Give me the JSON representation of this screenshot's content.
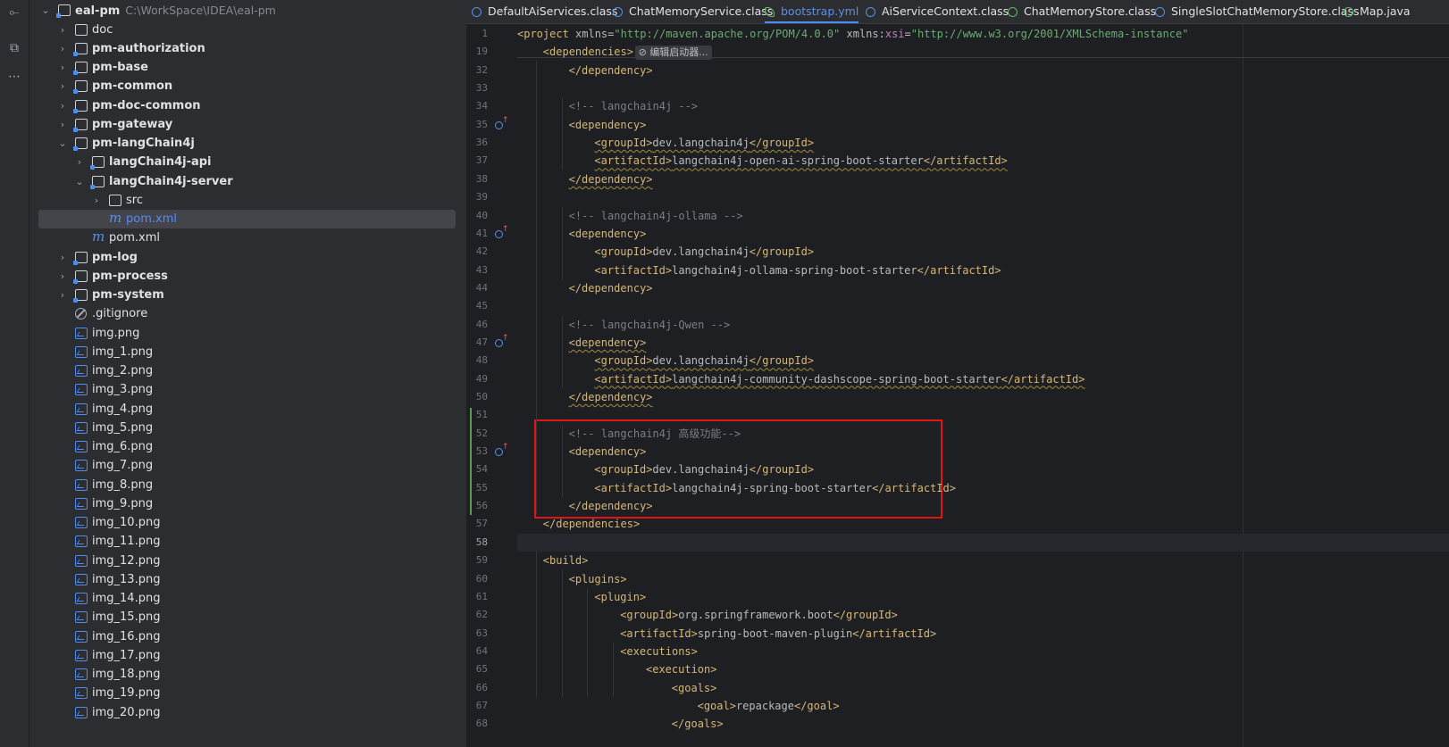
{
  "tree": {
    "root": {
      "name": "eal-pm",
      "path": "C:\\WorkSpace\\IDEA\\eal-pm"
    },
    "items": [
      {
        "label": "doc",
        "level": 1,
        "kind": "folder",
        "bold": false
      },
      {
        "label": "pm-authorization",
        "level": 1,
        "kind": "module",
        "bold": true
      },
      {
        "label": "pm-base",
        "level": 1,
        "kind": "module",
        "bold": true
      },
      {
        "label": "pm-common",
        "level": 1,
        "kind": "module",
        "bold": true
      },
      {
        "label": "pm-doc-common",
        "level": 1,
        "kind": "module",
        "bold": true
      },
      {
        "label": "pm-gateway",
        "level": 1,
        "kind": "module",
        "bold": true
      },
      {
        "label": "pm-langChain4j",
        "level": 1,
        "kind": "module",
        "bold": true,
        "expanded": true
      },
      {
        "label": "langChain4j-api",
        "level": 2,
        "kind": "module",
        "bold": true
      },
      {
        "label": "langChain4j-server",
        "level": 2,
        "kind": "module",
        "bold": true,
        "expanded": true
      },
      {
        "label": "src",
        "level": 3,
        "kind": "folder",
        "bold": false
      },
      {
        "label": "pom.xml",
        "level": 3,
        "kind": "maven",
        "bold": false,
        "selected": true
      },
      {
        "label": "pom.xml",
        "level": 2,
        "kind": "maven",
        "bold": false
      },
      {
        "label": "pm-log",
        "level": 1,
        "kind": "module",
        "bold": true
      },
      {
        "label": "pm-process",
        "level": 1,
        "kind": "module",
        "bold": true
      },
      {
        "label": "pm-system",
        "level": 1,
        "kind": "module",
        "bold": true
      },
      {
        "label": ".gitignore",
        "level": 1,
        "kind": "ignore",
        "bold": false
      },
      {
        "label": "img.png",
        "level": 1,
        "kind": "image",
        "bold": false
      },
      {
        "label": "img_1.png",
        "level": 1,
        "kind": "image",
        "bold": false
      },
      {
        "label": "img_2.png",
        "level": 1,
        "kind": "image",
        "bold": false
      },
      {
        "label": "img_3.png",
        "level": 1,
        "kind": "image",
        "bold": false
      },
      {
        "label": "img_4.png",
        "level": 1,
        "kind": "image",
        "bold": false
      },
      {
        "label": "img_5.png",
        "level": 1,
        "kind": "image",
        "bold": false
      },
      {
        "label": "img_6.png",
        "level": 1,
        "kind": "image",
        "bold": false
      },
      {
        "label": "img_7.png",
        "level": 1,
        "kind": "image",
        "bold": false
      },
      {
        "label": "img_8.png",
        "level": 1,
        "kind": "image",
        "bold": false
      },
      {
        "label": "img_9.png",
        "level": 1,
        "kind": "image",
        "bold": false
      },
      {
        "label": "img_10.png",
        "level": 1,
        "kind": "image",
        "bold": false
      },
      {
        "label": "img_11.png",
        "level": 1,
        "kind": "image",
        "bold": false
      },
      {
        "label": "img_12.png",
        "level": 1,
        "kind": "image",
        "bold": false
      },
      {
        "label": "img_13.png",
        "level": 1,
        "kind": "image",
        "bold": false
      },
      {
        "label": "img_14.png",
        "level": 1,
        "kind": "image",
        "bold": false
      },
      {
        "label": "img_15.png",
        "level": 1,
        "kind": "image",
        "bold": false
      },
      {
        "label": "img_16.png",
        "level": 1,
        "kind": "image",
        "bold": false
      },
      {
        "label": "img_17.png",
        "level": 1,
        "kind": "image",
        "bold": false
      },
      {
        "label": "img_18.png",
        "level": 1,
        "kind": "image",
        "bold": false
      },
      {
        "label": "img_19.png",
        "level": 1,
        "kind": "image",
        "bold": false
      },
      {
        "label": "img_20.png",
        "level": 1,
        "kind": "image",
        "bold": false
      }
    ]
  },
  "tabs": [
    {
      "label": "DefaultAiServices.class",
      "icon": "class"
    },
    {
      "label": "ChatMemoryService.class",
      "icon": "class"
    },
    {
      "label": "bootstrap.yml",
      "icon": "spring-leaf",
      "active": true
    },
    {
      "label": "AiServiceContext.class",
      "icon": "class"
    },
    {
      "label": "ChatMemoryStore.class",
      "icon": "interface"
    },
    {
      "label": "SingleSlotChatMemoryStore.class",
      "icon": "class"
    },
    {
      "label": "Map.java",
      "icon": "interface"
    }
  ],
  "inlay_hint": "编辑启动器...",
  "current_line": "58",
  "code": [
    {
      "n": "1",
      "indent": 0,
      "tokens": [
        [
          "t",
          "<project "
        ],
        [
          "a",
          "xmlns="
        ],
        [
          "s",
          "\"http://maven.apache.org/POM/4.0.0\""
        ],
        [
          "a",
          " xmlns:"
        ],
        [
          "ns",
          "xsi"
        ],
        [
          "a",
          "="
        ],
        [
          "s",
          "\"http://www.w3.org/2001/XMLSchema-instance\""
        ]
      ]
    },
    {
      "n": "19",
      "indent": 1,
      "tokens": [
        [
          "t",
          "<dependencies>"
        ]
      ]
    },
    {
      "n": "32",
      "indent": 2,
      "tokens": [
        [
          "t",
          "</dependency>"
        ]
      ]
    },
    {
      "n": "33",
      "indent": 0,
      "tokens": []
    },
    {
      "n": "34",
      "indent": 2,
      "tokens": [
        [
          "c",
          "<!-- langchain4j -->"
        ]
      ]
    },
    {
      "n": "35",
      "indent": 2,
      "marker": true,
      "tokens": [
        [
          "t",
          "<dependency>"
        ]
      ]
    },
    {
      "n": "36",
      "indent": 3,
      "wavy": true,
      "tokens": [
        [
          "t",
          "<groupId>"
        ],
        [
          "a",
          "dev.langchain4j"
        ],
        [
          "t",
          "</groupId>"
        ]
      ]
    },
    {
      "n": "37",
      "indent": 3,
      "wavy": true,
      "tokens": [
        [
          "t",
          "<artifactId>"
        ],
        [
          "a",
          "langchain4j-open-ai-spring-boot-starter"
        ],
        [
          "t",
          "</artifactId>"
        ]
      ]
    },
    {
      "n": "38",
      "indent": 2,
      "wavy": true,
      "tokens": [
        [
          "t",
          "</dependency>"
        ]
      ]
    },
    {
      "n": "39",
      "indent": 0,
      "tokens": []
    },
    {
      "n": "40",
      "indent": 2,
      "tokens": [
        [
          "c",
          "<!-- langchain4j-ollama -->"
        ]
      ]
    },
    {
      "n": "41",
      "indent": 2,
      "marker": true,
      "tokens": [
        [
          "t",
          "<dependency>"
        ]
      ]
    },
    {
      "n": "42",
      "indent": 3,
      "tokens": [
        [
          "t",
          "<groupId>"
        ],
        [
          "a",
          "dev.langchain4j"
        ],
        [
          "t",
          "</groupId>"
        ]
      ]
    },
    {
      "n": "43",
      "indent": 3,
      "tokens": [
        [
          "t",
          "<artifactId>"
        ],
        [
          "a",
          "langchain4j-ollama-spring-boot-starter"
        ],
        [
          "t",
          "</artifactId>"
        ]
      ]
    },
    {
      "n": "44",
      "indent": 2,
      "tokens": [
        [
          "t",
          "</dependency>"
        ]
      ]
    },
    {
      "n": "45",
      "indent": 0,
      "tokens": []
    },
    {
      "n": "46",
      "indent": 2,
      "tokens": [
        [
          "c",
          "<!-- langchain4j-Qwen -->"
        ]
      ]
    },
    {
      "n": "47",
      "indent": 2,
      "marker": true,
      "wavy": true,
      "tokens": [
        [
          "t",
          "<dependency>"
        ]
      ]
    },
    {
      "n": "48",
      "indent": 3,
      "wavy": true,
      "tokens": [
        [
          "t",
          "<groupId>"
        ],
        [
          "a",
          "dev.langchain4j"
        ],
        [
          "t",
          "</groupId>"
        ]
      ]
    },
    {
      "n": "49",
      "indent": 3,
      "wavy": true,
      "tokens": [
        [
          "t",
          "<artifactId>"
        ],
        [
          "a",
          "langchain4j-community-dashscope-spring-boot-starter"
        ],
        [
          "t",
          "</artifactId>"
        ]
      ]
    },
    {
      "n": "50",
      "indent": 2,
      "wavy": true,
      "tokens": [
        [
          "t",
          "</dependency>"
        ]
      ]
    },
    {
      "n": "51",
      "indent": 0,
      "tokens": []
    },
    {
      "n": "52",
      "indent": 2,
      "tokens": [
        [
          "c",
          "<!-- langchain4j 高级功能-->"
        ]
      ]
    },
    {
      "n": "53",
      "indent": 2,
      "marker": true,
      "tokens": [
        [
          "t",
          "<dependency>"
        ]
      ]
    },
    {
      "n": "54",
      "indent": 3,
      "tokens": [
        [
          "t",
          "<groupId>"
        ],
        [
          "a",
          "dev.langchain4j"
        ],
        [
          "t",
          "</groupId>"
        ]
      ]
    },
    {
      "n": "55",
      "indent": 3,
      "tokens": [
        [
          "t",
          "<artifactId>"
        ],
        [
          "a",
          "langchain4j-spring-boot-starter"
        ],
        [
          "t",
          "</artifactId>"
        ]
      ]
    },
    {
      "n": "56",
      "indent": 2,
      "tokens": [
        [
          "t",
          "</dependency>"
        ]
      ]
    },
    {
      "n": "57",
      "indent": 1,
      "tokens": [
        [
          "t",
          "</dependencies>"
        ]
      ]
    },
    {
      "n": "58",
      "indent": 0,
      "tokens": []
    },
    {
      "n": "59",
      "indent": 1,
      "tokens": [
        [
          "t",
          "<build>"
        ]
      ]
    },
    {
      "n": "60",
      "indent": 2,
      "tokens": [
        [
          "t",
          "<plugins>"
        ]
      ]
    },
    {
      "n": "61",
      "indent": 3,
      "tokens": [
        [
          "t",
          "<plugin>"
        ]
      ]
    },
    {
      "n": "62",
      "indent": 4,
      "tokens": [
        [
          "t",
          "<groupId>"
        ],
        [
          "a",
          "org.springframework.boot"
        ],
        [
          "t",
          "</groupId>"
        ]
      ]
    },
    {
      "n": "63",
      "indent": 4,
      "tokens": [
        [
          "t",
          "<artifactId>"
        ],
        [
          "a",
          "spring-boot-maven-plugin"
        ],
        [
          "t",
          "</artifactId>"
        ]
      ]
    },
    {
      "n": "64",
      "indent": 4,
      "tokens": [
        [
          "t",
          "<executions>"
        ]
      ]
    },
    {
      "n": "65",
      "indent": 5,
      "tokens": [
        [
          "t",
          "<execution>"
        ]
      ]
    },
    {
      "n": "66",
      "indent": 6,
      "tokens": [
        [
          "t",
          "<goals>"
        ]
      ]
    },
    {
      "n": "67",
      "indent": 7,
      "tokens": [
        [
          "t",
          "<goal>"
        ],
        [
          "a",
          "repackage"
        ],
        [
          "t",
          "</goal>"
        ]
      ]
    },
    {
      "n": "68",
      "indent": 6,
      "tokens": [
        [
          "t",
          "</goals>"
        ]
      ]
    }
  ],
  "colors": {
    "accent": "#4b8cf5",
    "highlight_box": "#e01616",
    "tag": "#d5b778",
    "string": "#6aab73"
  }
}
